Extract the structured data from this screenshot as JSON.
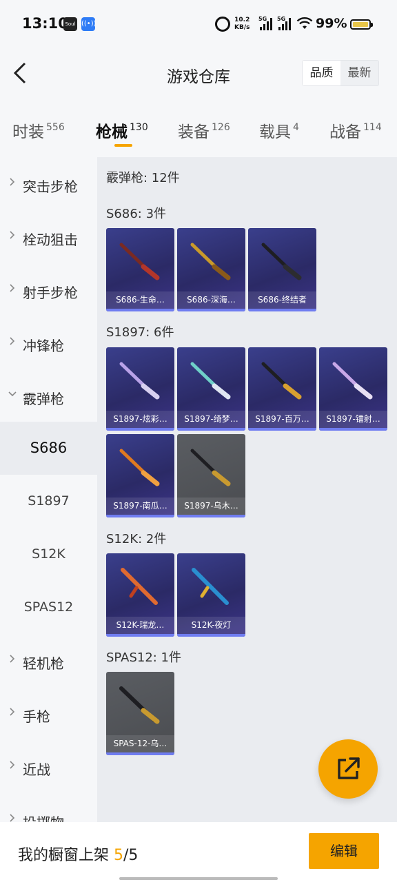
{
  "status_bar": {
    "time": "13:10",
    "app_icon_1": "Soul",
    "net_speed_value": "10.2",
    "net_speed_unit": "KB/s",
    "network_1": "5G",
    "network_2": "5G",
    "battery": "99%",
    "battery_level": 0.99
  },
  "header": {
    "title": "游戏仓库",
    "sort_options": [
      "品质",
      "最新"
    ],
    "sort_selected": "品质"
  },
  "tabs": [
    {
      "label": "时装",
      "count": "556"
    },
    {
      "label": "枪械",
      "count": "130"
    },
    {
      "label": "装备",
      "count": "126"
    },
    {
      "label": "载具",
      "count": "4"
    },
    {
      "label": "战备",
      "count": "114"
    }
  ],
  "sidebar": {
    "categories": [
      "突击步枪",
      "栓动狙击",
      "射手步枪",
      "冲锋枪",
      "霰弹枪",
      "轻机枪",
      "手枪",
      "近战",
      "投掷物"
    ],
    "expanded": "霰弹枪",
    "subitems": [
      "S686",
      "S1897",
      "S12K",
      "SPAS12"
    ],
    "selected_sub": "S686"
  },
  "content": {
    "section_title": "霰弹枪: 12件",
    "groups": [
      {
        "title": "S686: 3件",
        "items": [
          {
            "name": "S686-生命…",
            "quality": "purple"
          },
          {
            "name": "S686-深海…",
            "quality": "purple"
          },
          {
            "name": "S686-终结者",
            "quality": "purple"
          }
        ]
      },
      {
        "title": "S1897: 6件",
        "items": [
          {
            "name": "S1897-炫彩…",
            "quality": "purple"
          },
          {
            "name": "S1897-绮梦…",
            "quality": "purple"
          },
          {
            "name": "S1897-百万…",
            "quality": "purple"
          },
          {
            "name": "S1897-镭射…",
            "quality": "purple"
          },
          {
            "name": "S1897-南瓜…",
            "quality": "purple"
          },
          {
            "name": "S1897-乌木…",
            "quality": "grey"
          }
        ]
      },
      {
        "title": "S12K: 2件",
        "items": [
          {
            "name": "S12K-瑞龙…",
            "quality": "purple"
          },
          {
            "name": "S12K-夜灯",
            "quality": "purple"
          }
        ]
      },
      {
        "title": "SPAS12: 1件",
        "items": [
          {
            "name": "SPAS-12-乌…",
            "quality": "grey"
          }
        ]
      }
    ]
  },
  "bottom": {
    "showcase_label": "我的橱窗上架",
    "showcase_current": "5",
    "showcase_total": "/5",
    "edit_button": "编辑"
  },
  "colors": {
    "accent": "#f5a400",
    "card_purple": "#2b2a66",
    "card_grey": "#4a4c50",
    "card_bar": "#6f7cf0"
  },
  "icons": {
    "back": "back-arrow-icon",
    "share": "share-external-icon",
    "chevron": "chevron-right-icon"
  }
}
